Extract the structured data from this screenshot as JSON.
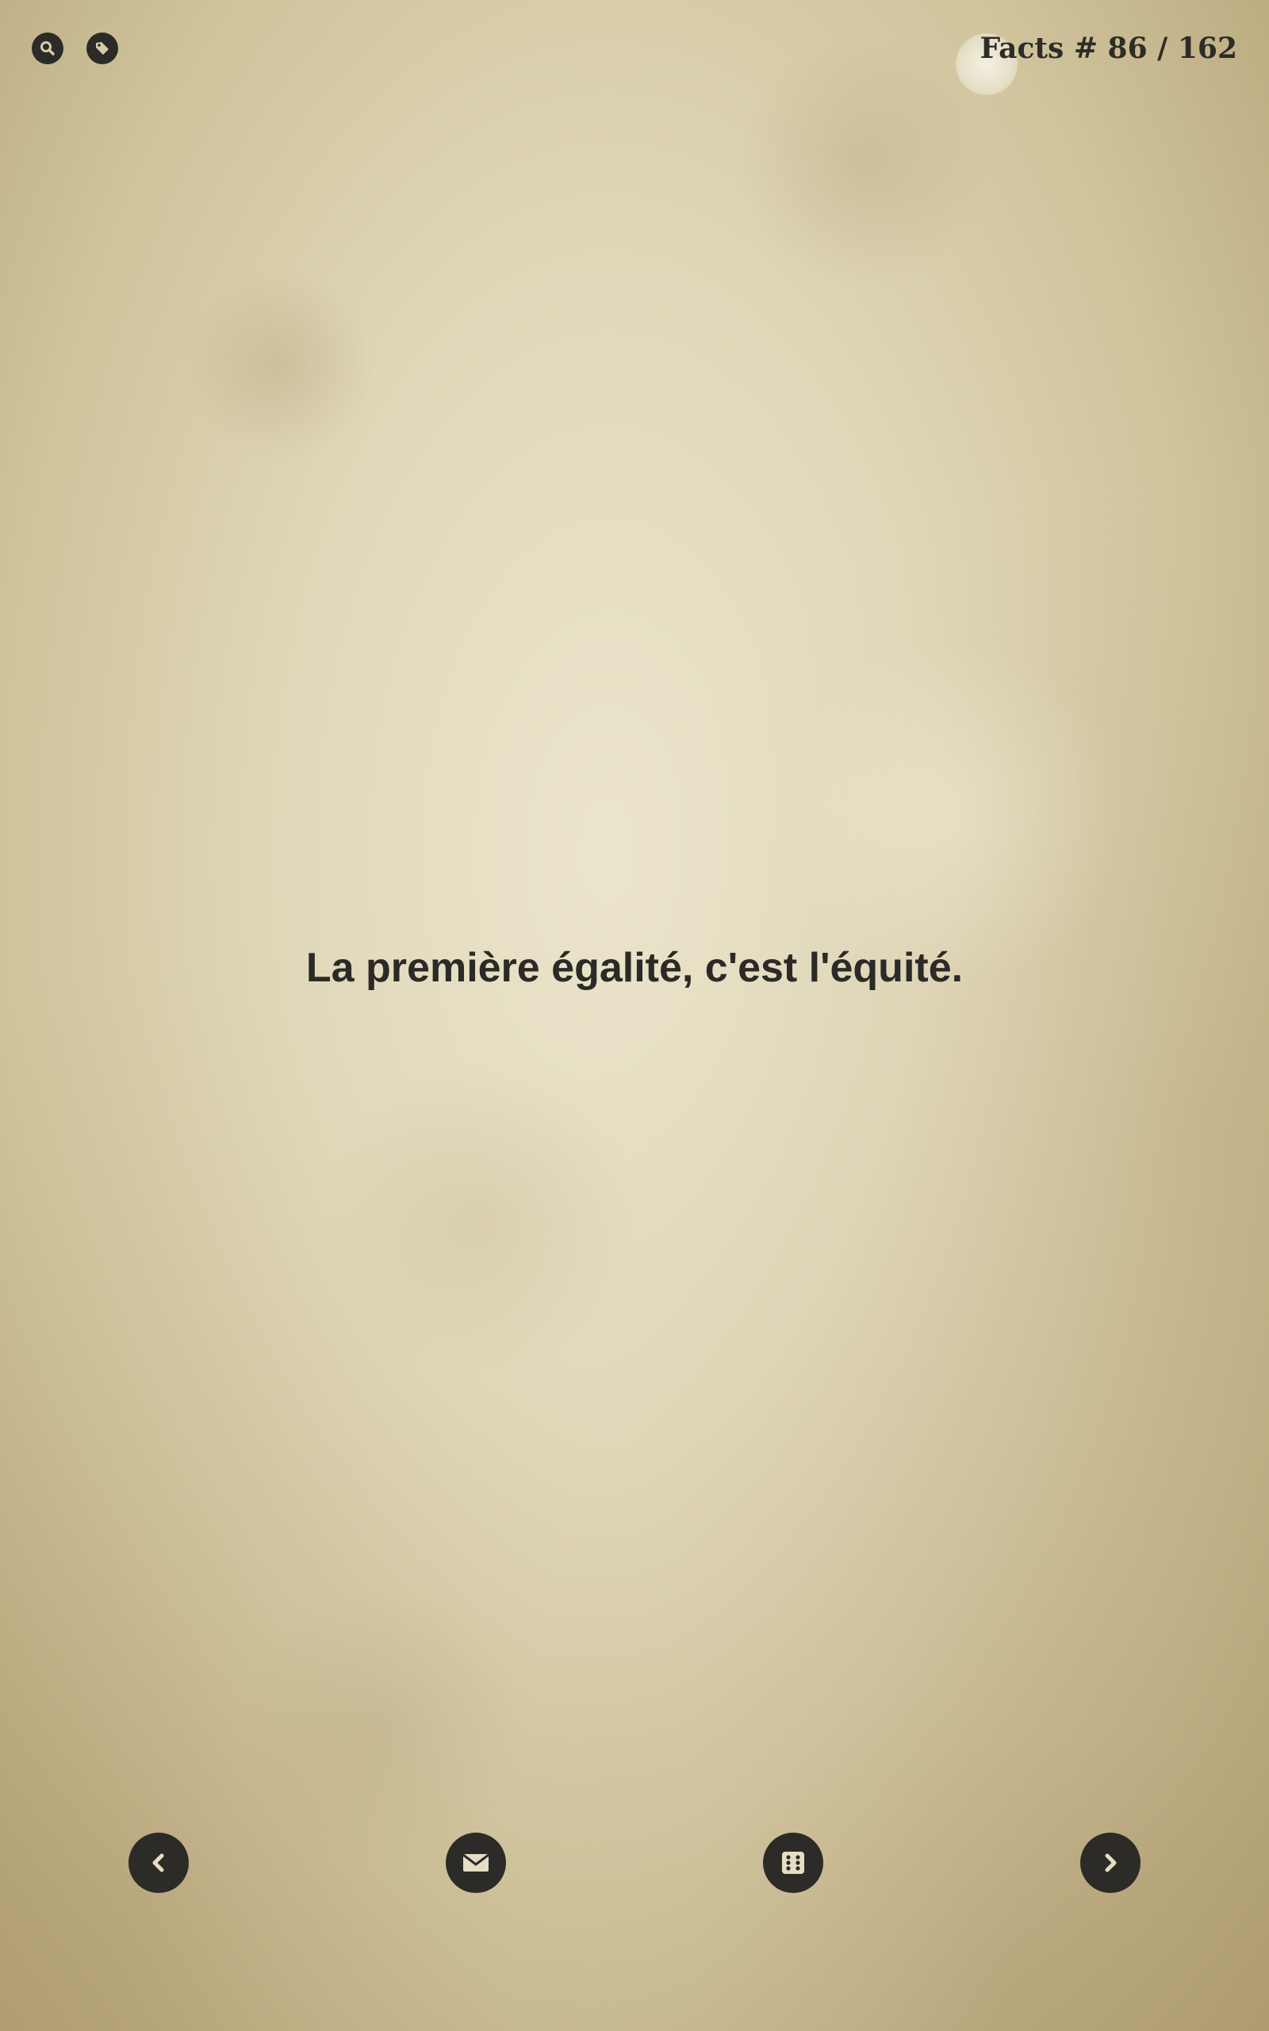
{
  "header": {
    "counter_text": "Facts # 86 / 162",
    "icons": [
      "search-icon",
      "tag-icon"
    ]
  },
  "fact": {
    "text": "La première égalité, c'est l'équité."
  },
  "footer": {
    "buttons": [
      "previous-icon",
      "mail-icon",
      "dice-icon",
      "next-icon"
    ]
  },
  "colors": {
    "icon_background": "#2c2b27",
    "text": "#2b2a26",
    "paper": "#d6ccaa"
  }
}
